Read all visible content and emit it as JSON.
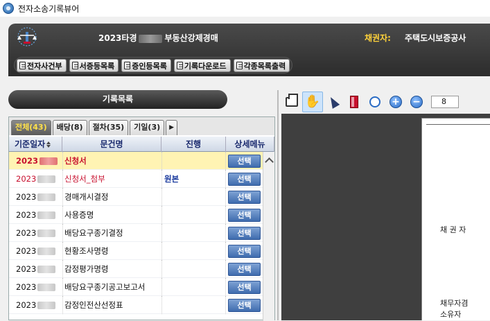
{
  "window": {
    "title": "전자소송기록뷰어"
  },
  "header": {
    "case_title_prefix": "2023타경",
    "case_title_suffix": "부동산강제경매",
    "creditor_label": "채권자:",
    "creditor_value": "주택도시보증공사"
  },
  "toolbar": {
    "buttons": [
      "전자사건부",
      "서증등목록",
      "증인등목록",
      "기록다운로드",
      "각종목록출력"
    ]
  },
  "record_list": {
    "section_title": "기록목록",
    "tabs": [
      "전체(43)",
      "배당(8)",
      "절차(35)",
      "기일(3)"
    ],
    "tab_more": "▶",
    "columns": [
      "기준일자",
      "문건명",
      "진행",
      "상세메뉴"
    ],
    "action_label": "선택",
    "rows": [
      {
        "date": "2023",
        "name": "신청서",
        "progress": "",
        "selected": true,
        "red": true
      },
      {
        "date": "2023",
        "name": "신청서_첨부",
        "progress": "원본",
        "selected": false,
        "red": true
      },
      {
        "date": "2023",
        "name": "경매개시결정",
        "progress": "",
        "selected": false,
        "red": false
      },
      {
        "date": "2023",
        "name": "사용증명",
        "progress": "",
        "selected": false,
        "red": false
      },
      {
        "date": "2023",
        "name": "배당요구종기결정",
        "progress": "",
        "selected": false,
        "red": false
      },
      {
        "date": "2023",
        "name": "현황조사명령",
        "progress": "",
        "selected": false,
        "red": false
      },
      {
        "date": "2023",
        "name": "감정평가명령",
        "progress": "",
        "selected": false,
        "red": false
      },
      {
        "date": "2023",
        "name": "배당요구종기공고보고서",
        "progress": "",
        "selected": false,
        "red": false
      },
      {
        "date": "2023",
        "name": "감정인전산선정표",
        "progress": "",
        "selected": false,
        "red": false
      }
    ]
  },
  "viewer": {
    "zoom_value": "8",
    "page_labels": {
      "creditor": "채 권 자",
      "debtor_line1": "채무자겸",
      "debtor_line2": "소유자"
    }
  },
  "colors": {
    "accent": "#3f6cae",
    "header_bg": "#2c2c2c",
    "creditor_label": "#ffd23a",
    "selected_row": "#fff3b3"
  }
}
